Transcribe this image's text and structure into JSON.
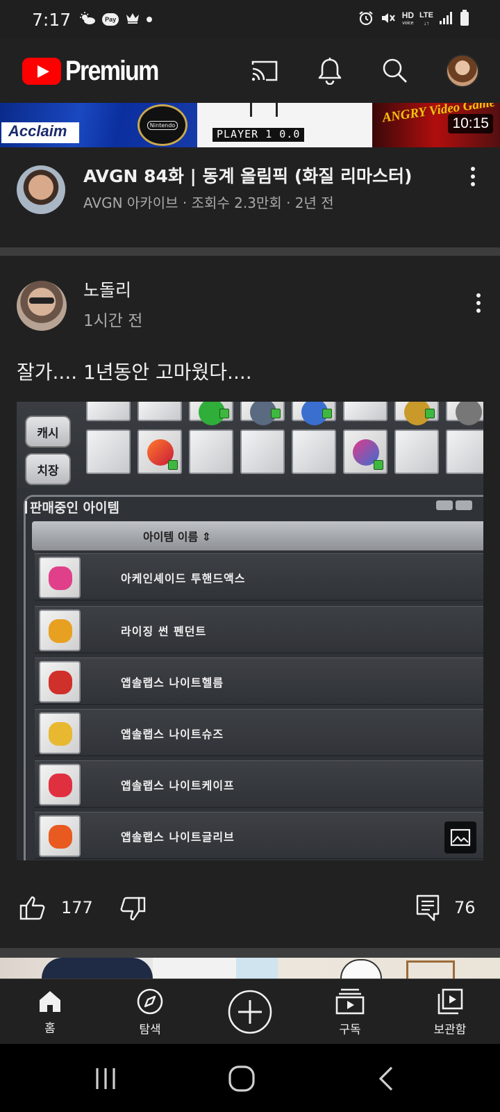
{
  "status_bar": {
    "time": "7:17",
    "pay_label": "Pay",
    "hd_label": "HD",
    "hd_sub": "voice",
    "lte_label": "LTE",
    "lte_sub": "↓↑"
  },
  "header": {
    "logo_text": "Premium"
  },
  "video": {
    "thumbnail": {
      "publisher_text": "Acclaim",
      "seal_text": "Nintendo",
      "game_text": "PLAYER 1    0.0",
      "brand_text": "ANGRY Video Game",
      "duration": "10:15"
    },
    "title": "AVGN 84화 | 동계 올림픽 (화질 리마스터)",
    "meta": "AVGN 아카이브 · 조회수 2.3만회 · 2년 전"
  },
  "post": {
    "author": "노돌리",
    "time": "1시간 전",
    "text": "잘가.... 1년동안 고마웠다....",
    "image": {
      "side_buttons": [
        "캐시",
        "치장"
      ],
      "panel_title": "판매중인 아이템",
      "column_header": "아이템 이름 ⇕",
      "items": [
        {
          "name": "아케인셰이드 투핸드액스",
          "color": "#e0408a"
        },
        {
          "name": "라이징 썬 펜던트",
          "color": "#e8a020"
        },
        {
          "name": "앱솔랩스 나이트헬름",
          "color": "#d0302a"
        },
        {
          "name": "앱솔랩스 나이트슈즈",
          "color": "#e8b830"
        },
        {
          "name": "앱솔랩스 나이트케이프",
          "color": "#e03040"
        },
        {
          "name": "앱솔랩스 나이트글리브",
          "color": "#e85a20"
        }
      ]
    },
    "likes": "177",
    "comments": "76"
  },
  "bottom_nav": {
    "items": [
      {
        "label": "홈",
        "icon": "home-icon"
      },
      {
        "label": "탐색",
        "icon": "explore-icon"
      },
      {
        "label": "",
        "icon": "create-icon"
      },
      {
        "label": "구독",
        "icon": "subscriptions-icon"
      },
      {
        "label": "보관함",
        "icon": "library-icon"
      }
    ]
  },
  "colors": {
    "background": "#212121",
    "brand_red": "#ff0000",
    "text_primary": "#f1f1f1",
    "text_secondary": "#aaaaaa"
  }
}
